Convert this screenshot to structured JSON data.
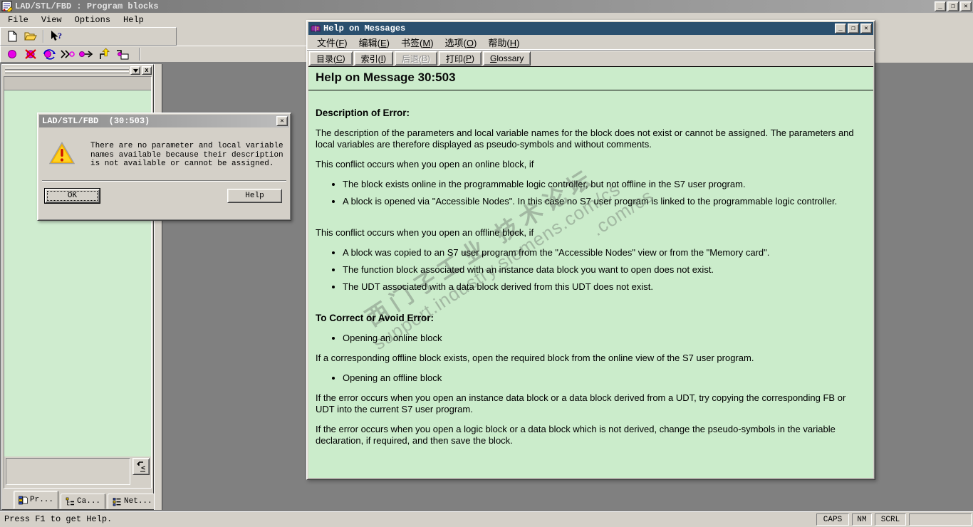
{
  "main_window": {
    "title": "LAD/STL/FBD : Program blocks",
    "menu": {
      "items": [
        "File",
        "View",
        "Options",
        "Help"
      ]
    },
    "toolbar_standard": {
      "icons": [
        "new-document",
        "open-folder",
        "context-help"
      ]
    },
    "toolbar_debug": {
      "icons": [
        "breakpoint",
        "delete-breakpoint",
        "breakpoints-active",
        "step-over",
        "continue-to",
        "step-out",
        "run-to-block"
      ]
    },
    "status_bar": {
      "message": "Press F1 to get Help.",
      "indicators": [
        "CAPS",
        "NM",
        "SCRL"
      ]
    }
  },
  "left_panel": {
    "tabs": [
      {
        "label": "Pr...",
        "icon": "program-elements-icon"
      },
      {
        "label": "Ca...",
        "icon": "call-structure-icon"
      },
      {
        "label": "Net...",
        "icon": "networks-icon"
      }
    ],
    "jump_button_icon": "jump-arrow"
  },
  "dialog": {
    "title": "LAD/STL/FBD  (30:503)",
    "message": "There are no parameter and local variable names available because their description is not available or cannot be assigned.",
    "buttons": {
      "ok": "OK",
      "help": "Help"
    },
    "icon": "warning-triangle"
  },
  "help_window": {
    "title": "Help on Messages",
    "menu": {
      "items": [
        {
          "label": "文件(F)",
          "hotkey": "F"
        },
        {
          "label": "编辑(E)",
          "hotkey": "E"
        },
        {
          "label": "书签(M)",
          "hotkey": "M"
        },
        {
          "label": "选项(O)",
          "hotkey": "O"
        },
        {
          "label": "帮助(H)",
          "hotkey": "H"
        }
      ]
    },
    "toolbar": {
      "buttons": [
        {
          "label": "目录(C)",
          "hotkey": "C",
          "enabled": true
        },
        {
          "label": "索引(I)",
          "hotkey": "I",
          "enabled": true
        },
        {
          "label": "后退(B)",
          "hotkey": "B",
          "enabled": false
        },
        {
          "label": "打印(P)",
          "hotkey": "P",
          "enabled": true
        },
        {
          "label": "Glossary",
          "hotkey": "G",
          "enabled": true
        }
      ]
    },
    "content": {
      "heading": "Help on Message 30:503",
      "desc_heading": "Description of Error:",
      "p1": "The description of the parameters and local variable names for the block does not exist or cannot be assigned. The parameters and local variables are therefore displayed as pseudo-symbols and without comments.",
      "p2": "This conflict occurs when you open an online block, if",
      "bullets_online": [
        "The block exists online in the programmable logic controller, but not offline in the S7 user program.",
        "A block is opened via \"Accessible Nodes\". In this case no S7 user program is linked to the programmable logic controller."
      ],
      "p3": "This conflict occurs when you open an offline block, if",
      "bullets_offline": [
        "A block was copied to an S7 user program from the \"Accessible Nodes\" view or from the \"Memory card\".",
        "The function block associated with an instance data block you want to open does not exist.",
        "The UDT associated with a data block derived from this UDT does not exist."
      ],
      "correct_heading": "To Correct or Avoid Error:",
      "bullet_open_online": "Opening an online block",
      "p4": "If a corresponding offline block exists, open the required block from the online view of the S7 user program.",
      "bullet_open_offline": "Opening an offline block",
      "p5": "If the error occurs when you open an instance data block or a data block derived from a UDT, try copying the corresponding FB or UDT into the current S7 user program.",
      "p6": "If the error occurs when you open a logic block or a data block which is not derived, change the pseudo-symbols in the variable declaration, if required, and then save the block."
    },
    "watermark": {
      "line1": "西门子工业 技术论坛",
      "line2": "support.industry.siemens.com/cs",
      "fragment": ".com/cs"
    }
  },
  "colors": {
    "chrome": "#d4d0c8",
    "desktop": "#808080",
    "help_titlebar": "#2a4f6e",
    "content_green": "#cbeccb",
    "warning_yellow": "#ffd21e",
    "breakpoint_magenta": "#e800e8"
  }
}
